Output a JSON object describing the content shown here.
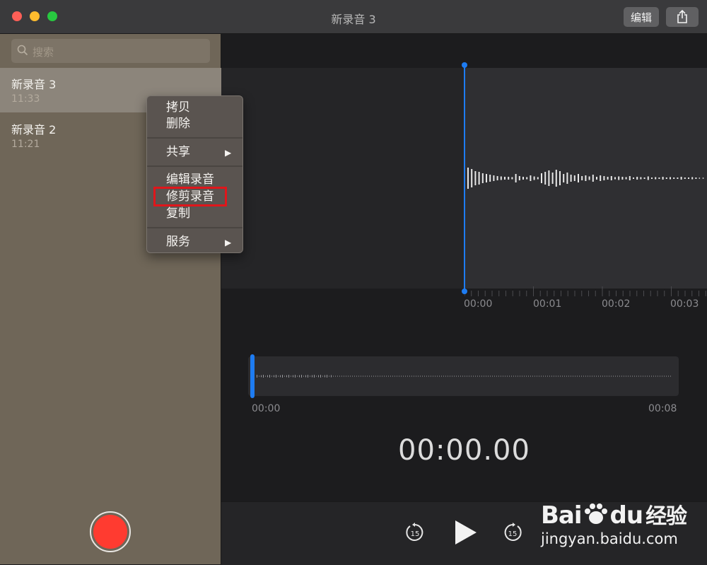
{
  "window": {
    "title": "新录音 3"
  },
  "toolbar": {
    "edit_label": "编辑",
    "share_icon": "share-icon"
  },
  "search": {
    "placeholder": "搜索"
  },
  "recordings": [
    {
      "title": "新录音 3",
      "time": "11:33",
      "selected": true
    },
    {
      "title": "新录音 2",
      "time": "11:21",
      "selected": false
    }
  ],
  "context_menu": {
    "items": [
      "拷贝",
      "删除",
      "共享",
      "编辑录音",
      "修剪录音",
      "复制",
      "服务"
    ],
    "highlighted": "修剪录音"
  },
  "waveform": {
    "tick_labels": [
      "00:00",
      "00:01",
      "00:02",
      "00:03"
    ]
  },
  "overview": {
    "start": "00:00",
    "end": "00:08"
  },
  "timer": "00:00.00",
  "controls": {
    "skip_back": "15",
    "skip_forward": "15"
  },
  "watermark": {
    "brand": "Bai",
    "brand2": "du",
    "brand3": "经验",
    "url": "jingyan.baidu.com"
  },
  "colors": {
    "accent": "#1e7cf2",
    "record": "#ff3b30",
    "sidebar": "#6f6658",
    "highlight": "#e0161b"
  }
}
